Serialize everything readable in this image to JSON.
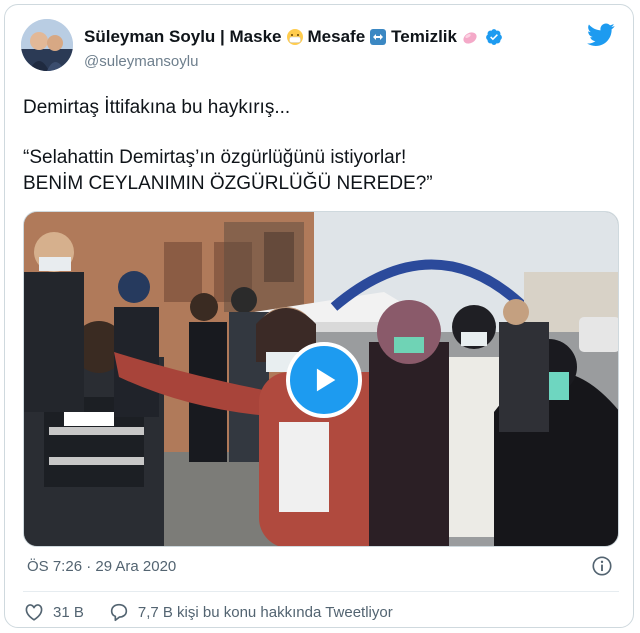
{
  "tweet": {
    "author_name": "Süleyman Soylu | Maske",
    "name_part2": "Mesafe",
    "name_part3": "Temizlik",
    "handle": "@suleymansoylu",
    "text_line1": "Demirtaş İttifakına bu haykırış...",
    "text_quote": "“Selahattin Demirtaş’ın özgürlüğünü istiyorlar!\nBENİM CEYLANIMIN ÖZGÜRLÜĞÜ NEREDE?”",
    "timestamp": "ÖS 7:26 · 29 Ara 2020",
    "likes": "31 B",
    "replies_text": "7,7 B kişi bu konu hakkında Tweetliyor"
  },
  "icons": {
    "brand": "twitter-bird-icon",
    "verified": "verified-badge-icon",
    "play": "play-icon",
    "info": "info-icon",
    "like": "heart-icon",
    "reply": "comment-icon"
  },
  "colors": {
    "accent": "#1d9bf0",
    "secondary_text": "#536471",
    "border": "#cfd9de"
  }
}
